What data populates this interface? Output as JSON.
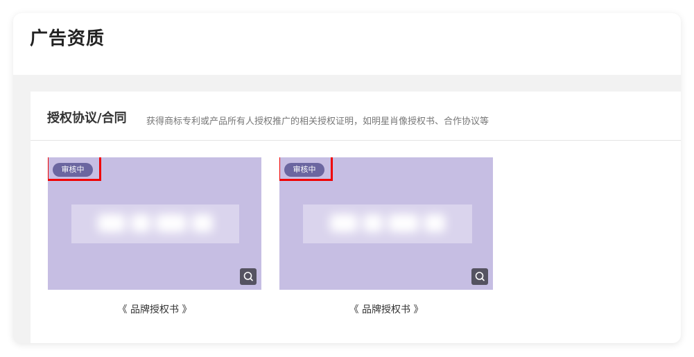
{
  "page": {
    "title": "广告资质"
  },
  "section": {
    "title": "授权协议/合同",
    "description": "获得商标专利或产品所有人授权推广的相关授权证明，如明星肖像授权书、合作协议等"
  },
  "documents": [
    {
      "status": "审核中",
      "name": "《 品牌授权书 》",
      "zoom_icon": "zoom-icon"
    },
    {
      "status": "审核中",
      "name": "《 品牌授权书 》",
      "zoom_icon": "zoom-icon"
    }
  ],
  "colors": {
    "thumbnail_bg": "#c6bee3",
    "status_badge_bg": "#6b66a0",
    "highlight_outline": "#f00000",
    "zoom_button_bg": "#555361"
  }
}
